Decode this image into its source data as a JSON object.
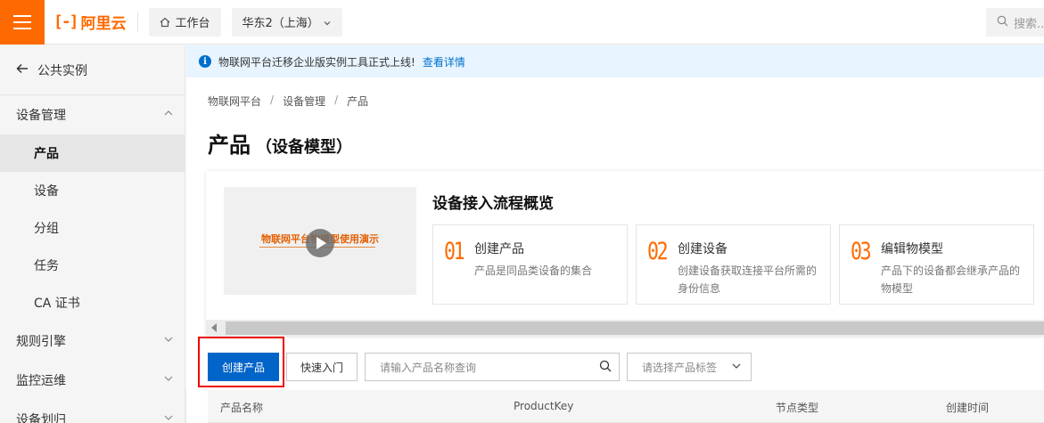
{
  "topbar": {
    "brand": "阿里云",
    "brand_mark": "[-]",
    "workbench": "工作台",
    "region": "华东2（上海）",
    "search_placeholder": "搜索..."
  },
  "sidebar": {
    "back": "公共实例",
    "groups": [
      {
        "label": "设备管理",
        "expanded": true,
        "items": [
          "产品",
          "设备",
          "分组",
          "任务",
          "CA 证书"
        ]
      },
      {
        "label": "规则引擎",
        "expanded": false
      },
      {
        "label": "监控运维",
        "expanded": false
      },
      {
        "label": "设备划归",
        "expanded": false
      }
    ],
    "active_item": "产品"
  },
  "notice": {
    "text": "物联网平台迁移企业版实例工具正式上线!",
    "link": "查看详情"
  },
  "breadcrumb": [
    "物联网平台",
    "设备管理",
    "产品"
  ],
  "page": {
    "title": "产品",
    "subtitle": "（设备模型）"
  },
  "overview": {
    "video_caption": "物联网平台物模型使用演示",
    "title": "设备接入流程概览",
    "steps": [
      {
        "num": "01",
        "title": "创建产品",
        "desc": "产品是同品类设备的集合"
      },
      {
        "num": "02",
        "title": "创建设备",
        "desc": "创建设备获取连接平台所需的身份信息"
      },
      {
        "num": "03",
        "title": "编辑物模型",
        "desc": "产品下的设备都会继承产品的物模型"
      }
    ]
  },
  "toolbar": {
    "create_button": "创建产品",
    "quick_start_button": "快速入门",
    "search_placeholder": "请输入产品名称查询",
    "tag_select_placeholder": "请选择产品标签"
  },
  "table": {
    "columns": [
      "产品名称",
      "ProductKey",
      "节点类型",
      "创建时间"
    ]
  },
  "colors": {
    "brand_orange": "#ff6a00",
    "primary_blue": "#0064c8",
    "highlight_red": "#ee0000"
  }
}
